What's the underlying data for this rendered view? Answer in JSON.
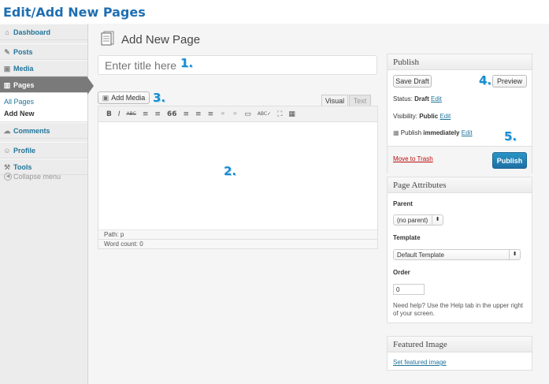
{
  "heading": "Edit/Add New Pages",
  "sidebar": {
    "items": [
      {
        "label": "Dashboard",
        "icon": "dashboard-icon"
      },
      {
        "label": "Posts",
        "icon": "pin-icon"
      },
      {
        "label": "Media",
        "icon": "media-icon"
      },
      {
        "label": "Pages",
        "icon": "pages-icon"
      }
    ],
    "submenu": [
      "All Pages",
      "Add New"
    ],
    "lower_items": [
      {
        "label": "Comments",
        "icon": "comments-icon"
      },
      {
        "label": "Profile",
        "icon": "profile-icon"
      },
      {
        "label": "Tools",
        "icon": "tools-icon"
      }
    ],
    "collapse_label": "Collapse menu"
  },
  "page_title": "Add New Page",
  "title_input": {
    "placeholder": "Enter title here"
  },
  "callouts": {
    "c1": "1.",
    "c2": "2.",
    "c3": "3.",
    "c4": "4.",
    "c5": "5."
  },
  "editor": {
    "add_media_label": "Add Media",
    "tab_visual": "Visual",
    "tab_text": "Text",
    "toolbar": [
      "B",
      "I",
      "ABC",
      "≡",
      "≡",
      "66",
      "≡",
      "≡",
      "≡",
      "⚭",
      "⚭",
      "▭",
      "ABC✓",
      "⛶",
      "▦"
    ],
    "path_label": "Path: p",
    "word_count_label": "Word count: 0"
  },
  "publish": {
    "title": "Publish",
    "save_draft_label": "Save Draft",
    "preview_label": "Preview",
    "status_prefix": "Status: ",
    "status_value": "Draft",
    "visibility_prefix": "Visibility: ",
    "visibility_value": "Public",
    "edit_label": "Edit",
    "publish_prefix": "Publish ",
    "publish_value": "immediately",
    "trash_label": "Move to Trash",
    "publish_label": "Publish"
  },
  "attributes": {
    "title": "Page Attributes",
    "parent_label": "Parent",
    "parent_value": "(no parent)",
    "template_label": "Template",
    "template_value": "Default Template",
    "order_label": "Order",
    "order_value": "0",
    "help_text": "Need help? Use the Help tab in the upper right of your screen."
  },
  "featured": {
    "title": "Featured Image",
    "link_label": "Set featured image"
  }
}
